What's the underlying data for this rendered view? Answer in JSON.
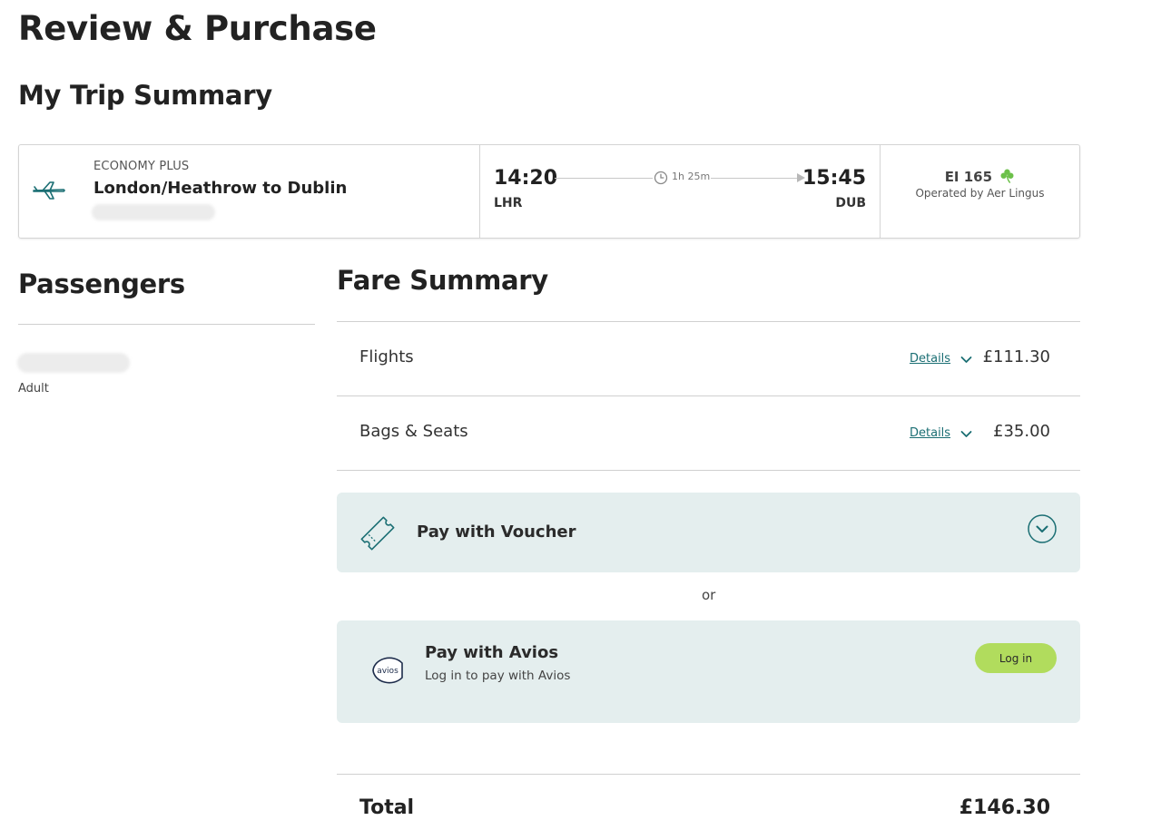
{
  "page": {
    "title": "Review & Purchase"
  },
  "trip_summary": {
    "title": "My Trip Summary",
    "cabin": "ECONOMY PLUS",
    "route": "London/Heathrow to Dublin",
    "departure_time": "14:20",
    "departure_code": "LHR",
    "arrival_time": "15:45",
    "arrival_code": "DUB",
    "duration": "1h 25m",
    "flight_number": "EI 165",
    "operated_by": "Operated by Aer Lingus",
    "icons": [
      "plane-icon",
      "clock-icon",
      "shamrock-icon"
    ]
  },
  "passengers": {
    "title": "Passengers",
    "items": [
      {
        "type": "Adult"
      }
    ]
  },
  "fare_summary": {
    "title": "Fare Summary",
    "rows": [
      {
        "label": "Flights",
        "details_label": "Details",
        "price": "£111.30"
      },
      {
        "label": "Bags & Seats",
        "details_label": "Details",
        "price": "£35.00"
      }
    ],
    "voucher": {
      "label": "Pay with Voucher"
    },
    "or_text": "or",
    "avios": {
      "title": "Pay with Avios",
      "subtitle": "Log in to pay with Avios",
      "logo_text": "avios",
      "login_label": "Log in"
    },
    "total_label": "Total",
    "total_price": "£146.30"
  },
  "colors": {
    "teal_accent": "#1a6e73",
    "panel_bg": "#e4eeee",
    "login_button": "#b1dc5d",
    "shamrock": "#6cc04a"
  }
}
